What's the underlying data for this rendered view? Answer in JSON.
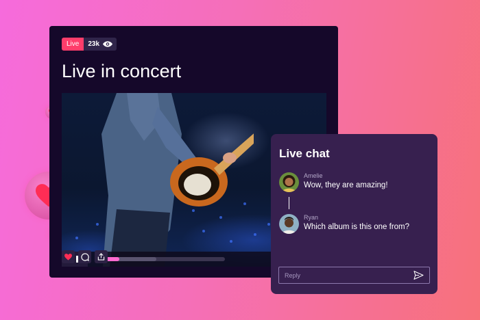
{
  "stream": {
    "live_badge": "Live",
    "viewer_count": "23k",
    "title": "Live in concert"
  },
  "player": {
    "progress": 0.17,
    "buffered": 0.46,
    "volume_level": 0.8
  },
  "actions": [
    {
      "name": "like-button",
      "icon": "heart-icon"
    },
    {
      "name": "comment-button",
      "icon": "comment-icon"
    },
    {
      "name": "share-button",
      "icon": "share-icon"
    }
  ],
  "chat": {
    "title": "Live chat",
    "messages": [
      {
        "author": "Amelie",
        "text": "Wow, they are amazing!"
      },
      {
        "author": "Ryan",
        "text": "Which album is this one from?"
      }
    ],
    "reply_placeholder": "Reply"
  },
  "colors": {
    "live": "#ff3d6b",
    "accent": "#ff6ad0",
    "card_bg": "#15082a",
    "chat_bg": "#37204f"
  }
}
